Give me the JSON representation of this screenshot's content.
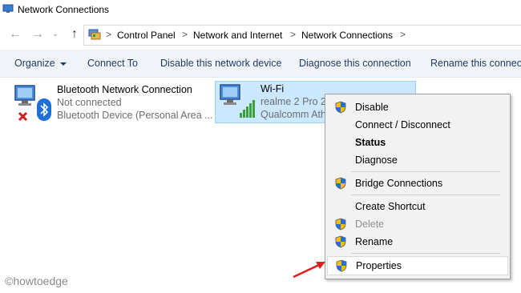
{
  "window": {
    "title": "Network Connections"
  },
  "breadcrumb": [
    "Control Panel",
    "Network and Internet",
    "Network Connections"
  ],
  "toolbar": {
    "organize": "Organize",
    "connect_to": "Connect To",
    "disable_device": "Disable this network device",
    "diagnose": "Diagnose this connection",
    "rename": "Rename this connecti"
  },
  "connections": [
    {
      "name": "Bluetooth Network Connection",
      "status": "Not connected",
      "device": "Bluetooth Device (Personal Area ..."
    },
    {
      "name": "Wi-Fi",
      "status": "realme 2 Pro 2",
      "device": "Qualcomm Ath"
    }
  ],
  "context_menu": {
    "items": [
      {
        "label": "Disable",
        "shield": true,
        "style": "normal"
      },
      {
        "label": "Connect / Disconnect",
        "shield": false,
        "style": "normal"
      },
      {
        "label": "Status",
        "shield": false,
        "style": "bold"
      },
      {
        "label": "Diagnose",
        "shield": false,
        "style": "normal"
      },
      {
        "label": "Bridge Connections",
        "shield": true,
        "style": "normal"
      },
      {
        "label": "Create Shortcut",
        "shield": false,
        "style": "normal"
      },
      {
        "label": "Delete",
        "shield": true,
        "style": "disabled"
      },
      {
        "label": "Rename",
        "shield": true,
        "style": "normal"
      },
      {
        "label": "Properties",
        "shield": true,
        "style": "highlighted"
      }
    ]
  },
  "watermark": "©howtoedge",
  "colors": {
    "toolbar_bg": "#f0f4f9",
    "selection_bg": "#cce8ff",
    "selection_border": "#99d1ff",
    "menu_bg": "#f2f2f2",
    "arrow": "#e02020"
  }
}
